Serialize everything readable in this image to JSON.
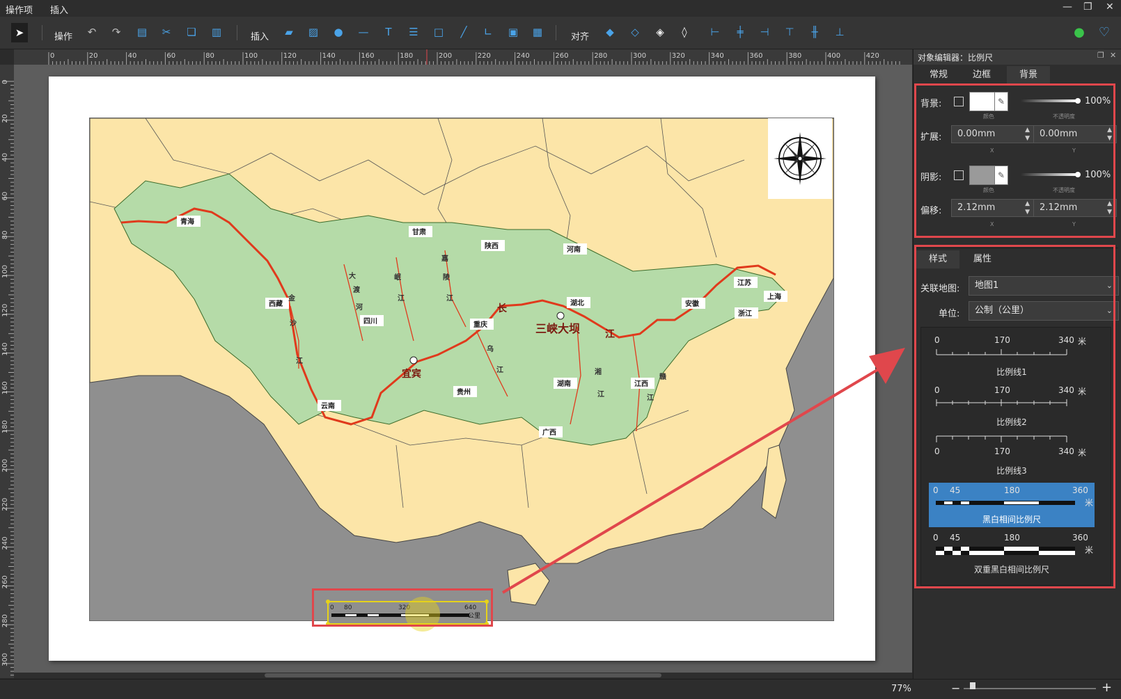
{
  "menu": {
    "items": [
      "操作项",
      "插入"
    ]
  },
  "window_controls": {
    "minimize": "—",
    "restore": "❐",
    "close": "✕"
  },
  "toolbar": {
    "operate_label": "操作",
    "insert_label": "插入",
    "align_label": "对齐"
  },
  "ruler": {
    "h_ticks": [
      "0",
      "20",
      "40",
      "60",
      "80",
      "100",
      "120",
      "140",
      "160",
      "180",
      "200",
      "220",
      "240",
      "260",
      "280",
      "300",
      "320",
      "340",
      "360",
      "380",
      "400",
      "420"
    ],
    "v_ticks": [
      "0",
      "20",
      "40",
      "60",
      "80",
      "100",
      "120",
      "140",
      "160",
      "180",
      "200",
      "220",
      "240",
      "260",
      "280",
      "300"
    ]
  },
  "map": {
    "labels": [
      "青海",
      "甘肃",
      "陕西",
      "河南",
      "西藏",
      "四川",
      "重庆",
      "湖北",
      "三峡大坝",
      "安徽",
      "江苏",
      "上海",
      "浙江",
      "贵州",
      "湖南",
      "江西",
      "云南",
      "广西",
      "宜宾"
    ],
    "river_labels": [
      "金",
      "沙",
      "江",
      "大",
      "渡",
      "河",
      "岷",
      "江",
      "嘉",
      "陵",
      "江",
      "乌",
      "江",
      "湘",
      "江",
      "赣",
      "江",
      "江",
      "长"
    ],
    "scalebar": {
      "ticks": [
        "0",
        "80",
        "320",
        "640"
      ],
      "unit": "公里"
    }
  },
  "inspector": {
    "title": "对象编辑器：比例尺",
    "tabs": [
      "常规",
      "边框",
      "背景"
    ],
    "active_tab": "背景",
    "background": {
      "label": "背景:",
      "color_caption": "颜色",
      "opacity_caption": "不透明度",
      "opacity": "100%",
      "color": "#ffffff"
    },
    "extend": {
      "label": "扩展:",
      "x_value": "0.00mm",
      "y_value": "0.00mm",
      "x_caption": "X",
      "y_caption": "Y"
    },
    "shadow": {
      "label": "阴影:",
      "color_caption": "颜色",
      "opacity_caption": "不透明度",
      "opacity": "100%",
      "color": "#9a9a9a"
    },
    "offset": {
      "label": "偏移:",
      "x_value": "2.12mm",
      "y_value": "2.12mm",
      "x_caption": "X",
      "y_caption": "Y"
    },
    "subtabs": [
      "样式",
      "属性"
    ],
    "active_subtab": "样式",
    "linked_map": {
      "label": "关联地图:",
      "value": "地图1"
    },
    "unit": {
      "label": "单位:",
      "value": "公制（公里）"
    },
    "styles": [
      {
        "name": "比例线1",
        "ticks": [
          "0",
          "170",
          "340"
        ],
        "unit": "米",
        "selected": false
      },
      {
        "name": "比例线2",
        "ticks": [
          "0",
          "170",
          "340"
        ],
        "unit": "米",
        "selected": false
      },
      {
        "name": "比例线3",
        "ticks": [
          "0",
          "170",
          "340"
        ],
        "unit": "米",
        "selected": false
      },
      {
        "name": "黑白相间比例尺",
        "ticks": [
          "0",
          "45",
          "180",
          "360"
        ],
        "unit": "米",
        "selected": true
      },
      {
        "name": "双重黑白相间比例尺",
        "ticks": [
          "0",
          "45",
          "180",
          "360"
        ],
        "unit": "米",
        "selected": false
      }
    ]
  },
  "status": {
    "zoom": "77%",
    "zoom_out": "−",
    "zoom_in": "+"
  },
  "colors": {
    "accent": "#3b82c4",
    "highlight": "#e0474c",
    "map_land": "#fce5a8",
    "basin": "#b5dba8",
    "river": "#e03a1c",
    "selection": "#e6d21a"
  }
}
